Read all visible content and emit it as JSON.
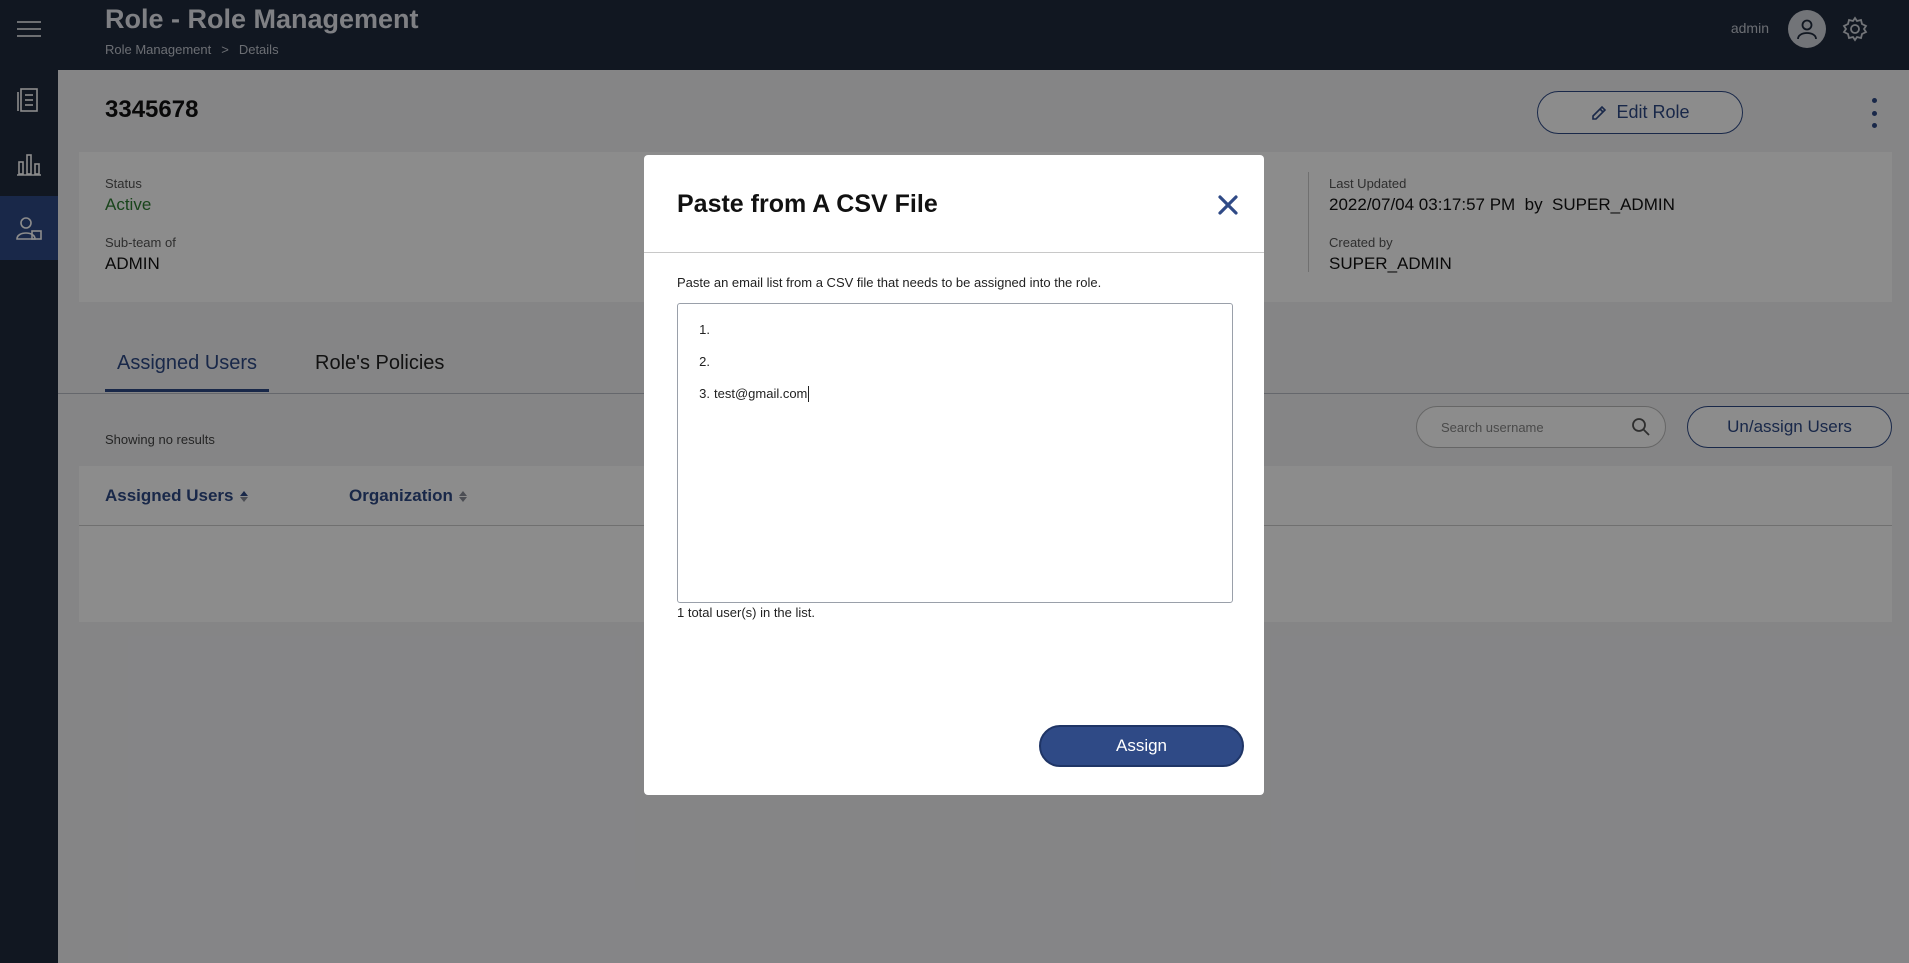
{
  "header": {
    "title": "Role - Role Management",
    "breadcrumb": [
      "Role Management",
      ">",
      "Details"
    ],
    "username": "admin"
  },
  "sidebar": {
    "items": [
      {
        "icon": "document-list-icon"
      },
      {
        "icon": "bar-chart-icon"
      },
      {
        "icon": "user-role-icon",
        "active": true
      }
    ]
  },
  "page": {
    "role_id": "3345678",
    "edit_button": "Edit Role"
  },
  "details": {
    "status_label": "Status",
    "status_value": "Active",
    "subteam_label": "Sub-team of",
    "subteam_value": "ADMIN",
    "last_updated_label": "Last Updated",
    "last_updated_value": "2022/07/04 03:17:57 PM  by  SUPER_ADMIN",
    "created_by_label": "Created by",
    "created_by_value": "SUPER_ADMIN"
  },
  "tabs": [
    {
      "label": "Assigned Users",
      "active": true
    },
    {
      "label": "Role's Policies",
      "active": false
    }
  ],
  "users_table": {
    "showing_text": "Showing no results",
    "search_placeholder": "Search username",
    "unassign_button": "Un/assign Users",
    "columns": [
      "Assigned Users",
      "Organization"
    ]
  },
  "modal": {
    "title": "Paste from A CSV File",
    "description": "Paste an email list from a CSV file that needs to be assigned into the role.",
    "lines": [
      {
        "num": "1.",
        "text": ""
      },
      {
        "num": "2.",
        "text": ""
      },
      {
        "num": "3.",
        "text": "test@gmail.com"
      }
    ],
    "count_text": "1 total user(s) in the list.",
    "assign_button": "Assign"
  },
  "colors": {
    "primary": "#2f4a86",
    "header_bg": "#1f2a3c",
    "status_active": "#2e7d32"
  }
}
